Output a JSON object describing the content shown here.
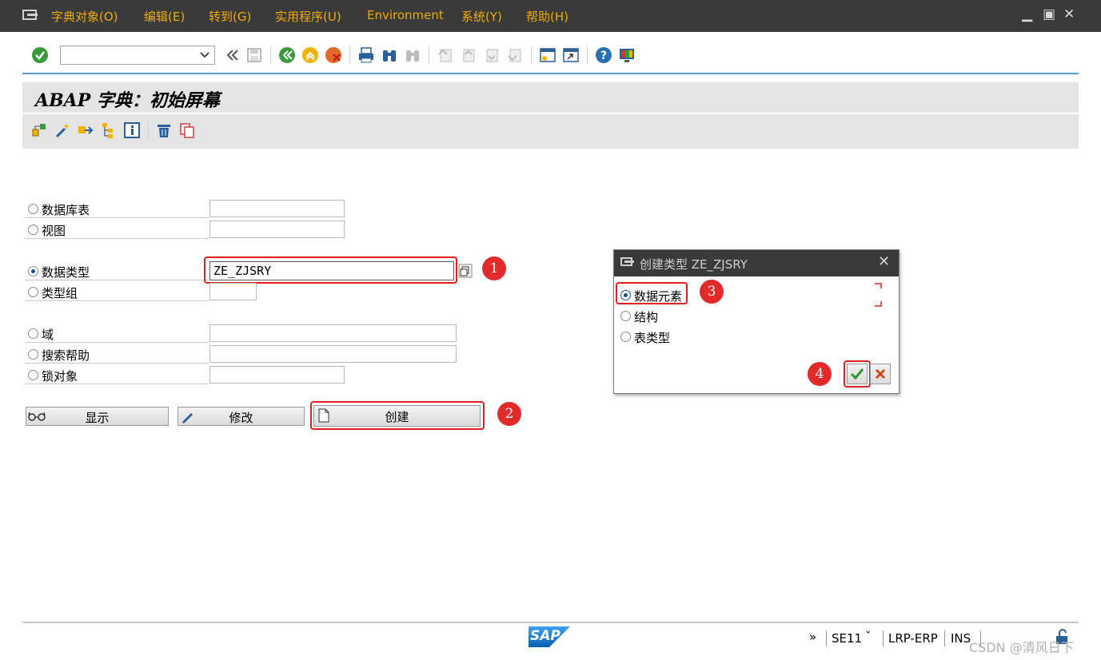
{
  "menubar": {
    "items": [
      "字典对象(O)",
      "编辑(E)",
      "转到(G)",
      "实用程序(U)",
      "Environment",
      "系统(Y)",
      "帮助(H)"
    ]
  },
  "toolbar": {
    "command_field_value": "",
    "icons": [
      "enter-icon",
      "back-double-icon",
      "save-icon",
      "back-icon",
      "exit-icon",
      "cancel-icon",
      "print-icon",
      "find-icon",
      "find-next-icon",
      "first-page-icon",
      "prev-page-icon",
      "next-page-icon",
      "last-page-icon",
      "new-session-icon",
      "shortcut-icon",
      "help-icon",
      "layout-icon"
    ]
  },
  "title": "ABAP 字典：初始屏幕",
  "app_toolbar": {
    "icons": [
      "other-object-icon",
      "wizard-icon",
      "move-icon",
      "hierarchy-icon",
      "info-icon",
      "delete-icon",
      "copy-icon"
    ]
  },
  "form": {
    "options": [
      {
        "label": "数据库表",
        "value": "",
        "selected": false
      },
      {
        "label": "视图",
        "value": "",
        "selected": false
      },
      {
        "label": "数据类型",
        "value": "ZE_ZJSRY",
        "selected": true
      },
      {
        "label": "类型组",
        "value": "",
        "selected": false
      },
      {
        "label": "域",
        "value": "",
        "selected": false
      },
      {
        "label": "搜索帮助",
        "value": "",
        "selected": false
      },
      {
        "label": "锁对象",
        "value": "",
        "selected": false
      }
    ],
    "buttons": {
      "display": "显示",
      "change": "修改",
      "create": "创建"
    }
  },
  "annotations": [
    "1",
    "2",
    "3",
    "4"
  ],
  "dialog": {
    "title": "创建类型 ZE_ZJSRY",
    "options": [
      {
        "label": "数据元素",
        "selected": true
      },
      {
        "label": "结构",
        "selected": false
      },
      {
        "label": "表类型",
        "selected": false
      }
    ]
  },
  "statusbar": {
    "brand": "SAP",
    "more": "»",
    "transaction": "SE11",
    "server": "LRP-ERP",
    "mode": "INS",
    "watermark": "CSDN @清风日下"
  },
  "colors": {
    "menu_text": "#f0ab00",
    "menubar_bg": "#3a3a3a",
    "highlight": "#e02020",
    "panel_bg": "#e4e4e4"
  }
}
